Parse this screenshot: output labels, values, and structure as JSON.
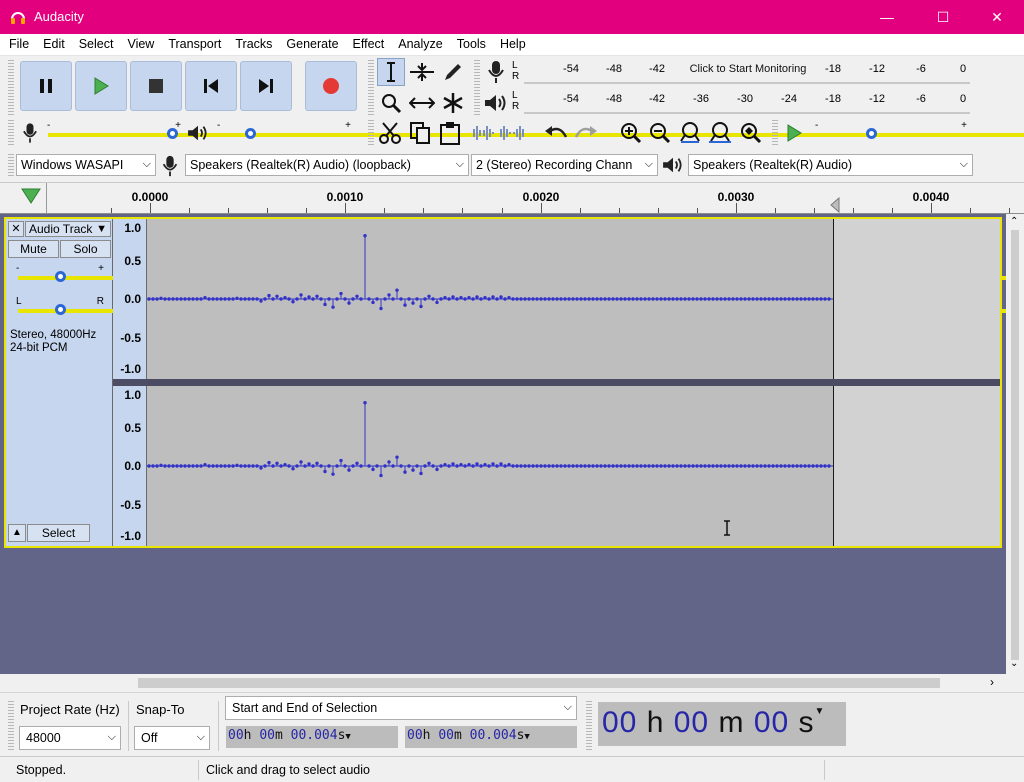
{
  "window": {
    "title": "Audacity",
    "minimize": "—",
    "maximize": "☐",
    "close": "✕"
  },
  "menu": [
    "File",
    "Edit",
    "Select",
    "View",
    "Transport",
    "Tracks",
    "Generate",
    "Effect",
    "Analyze",
    "Tools",
    "Help"
  ],
  "record_meter": {
    "scale": [
      "-54",
      "-48",
      "-42",
      "-18",
      "-12",
      "-6",
      "0"
    ],
    "hint": "Click to Start Monitoring",
    "left": "L",
    "right": "R"
  },
  "play_meter": {
    "scale": [
      "-54",
      "-48",
      "-42",
      "-36",
      "-30",
      "-24",
      "-18",
      "-12",
      "-6",
      "0"
    ],
    "left": "L",
    "right": "R"
  },
  "mixer": {
    "minus": "-",
    "plus": "+",
    "record_volume": 0.98,
    "playback_volume": 0.22
  },
  "play_at_speed": {
    "minus": "-",
    "plus": "+",
    "speed": 0.36
  },
  "devices": {
    "host": "Windows WASAPI",
    "recording_device": "Speakers (Realtek(R) Audio) (loopback)",
    "channels": "2 (Stereo) Recording Chann",
    "playback_device": "Speakers (Realtek(R) Audio)"
  },
  "ruler": {
    "labels": [
      "0.0000",
      "0.0010",
      "0.0020",
      "0.0030",
      "0.0040"
    ]
  },
  "track": {
    "close": "✕",
    "name": "Audio Track",
    "mute": "Mute",
    "solo": "Solo",
    "gain_minus": "-",
    "gain_plus": "+",
    "pan_left": "L",
    "pan_right": "R",
    "format_line1": "Stereo, 48000Hz",
    "format_line2": "24-bit PCM",
    "select": "Select",
    "collapse": "▲",
    "scale": [
      "1.0",
      "0.5",
      "0.0",
      "-0.5",
      "-1.0"
    ],
    "gain": 0.5,
    "pan": 0.5
  },
  "selection": {
    "project_rate_label": "Project Rate (Hz)",
    "project_rate": "48000",
    "snap_label": "Snap-To",
    "snap": "Off",
    "mode": "Start and End of Selection",
    "start": {
      "hh": "00",
      "mm": "00",
      "ss": "00.004"
    },
    "end": {
      "hh": "00",
      "mm": "00",
      "ss": "00.004"
    },
    "h": "h",
    "m": "m",
    "s": "s"
  },
  "audio_position": {
    "hh": "00",
    "h": "h",
    "mm": "00",
    "m": "m",
    "ss": "00",
    "s": "s"
  },
  "status": {
    "state": "Stopped.",
    "hint": "Click and drag to select audio"
  },
  "colors": {
    "titlebar": "#e3007f",
    "waveform": "#3232c8",
    "track_panel": "#c5d6ee",
    "background": "#626588"
  }
}
